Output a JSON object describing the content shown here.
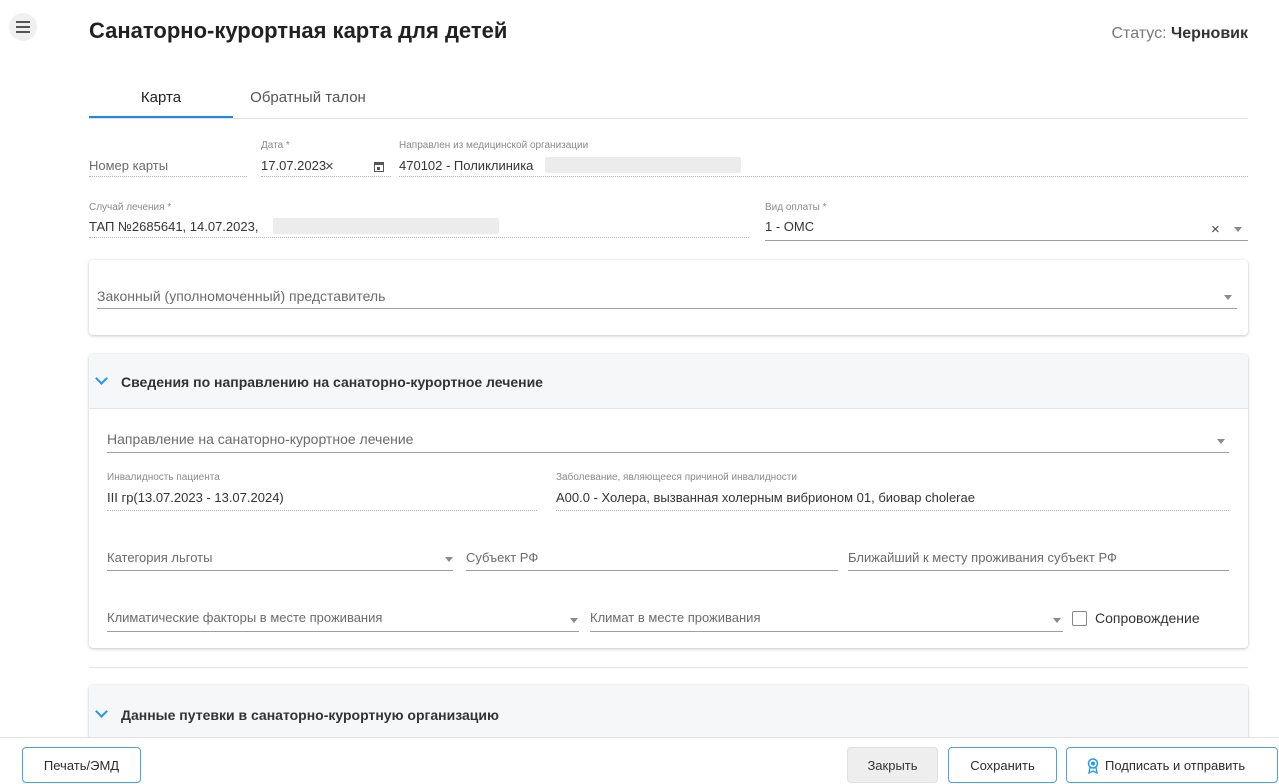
{
  "header": {
    "title": "Санаторно-курортная карта для детей",
    "status_label": "Статус:",
    "status_value": "Черновик"
  },
  "tabs": [
    {
      "label": "Карта",
      "active": true
    },
    {
      "label": "Обратный талон",
      "active": false
    }
  ],
  "form": {
    "card_number_placeholder": "Номер карты",
    "date_label": "Дата *",
    "date_value": "17.07.2023",
    "referred_from_label": "Направлен из медицинской организации",
    "referred_from_value": "470102 - Поликлиника",
    "treatment_case_label": "Случай лечения *",
    "treatment_case_value": "ТАП №2685641, 14.07.2023,",
    "payment_type_label": "Вид оплаты *",
    "payment_type_value": "1 - ОМС",
    "legal_rep_placeholder": "Законный (уполномоченный) представитель"
  },
  "referral_section": {
    "title": "Сведения по направлению на санаторно-курортное лечение",
    "referral_placeholder": "Направление на санаторно-курортное лечение",
    "disability_label": "Инвалидность пациента",
    "disability_value": "III гр(13.07.2023 - 13.07.2024)",
    "disease_label": "Заболевание, являющееся причиной инвалидности",
    "disease_value": "A00.0 - Холера, вызванная холерным вибрионом 01, биовар cholerae",
    "benefit_category_placeholder": "Категория льготы",
    "subject_rf_placeholder": "Субъект РФ",
    "nearest_subject_placeholder": "Ближайший к месту проживания субъект РФ",
    "climate_factors_placeholder": "Климатические факторы в месте проживания",
    "climate_placeholder": "Климат в месте проживания",
    "escort_label": "Сопровождение"
  },
  "voucher_section": {
    "title": "Данные путевки в санаторно-курортную организацию"
  },
  "footer": {
    "print_label": "Печать/ЭМД",
    "close_label": "Закрыть",
    "save_label": "Сохранить",
    "sign_send_label": "Подписать и отправить"
  },
  "colors": {
    "accent": "#1e88e5",
    "chevron": "#2196f3"
  }
}
